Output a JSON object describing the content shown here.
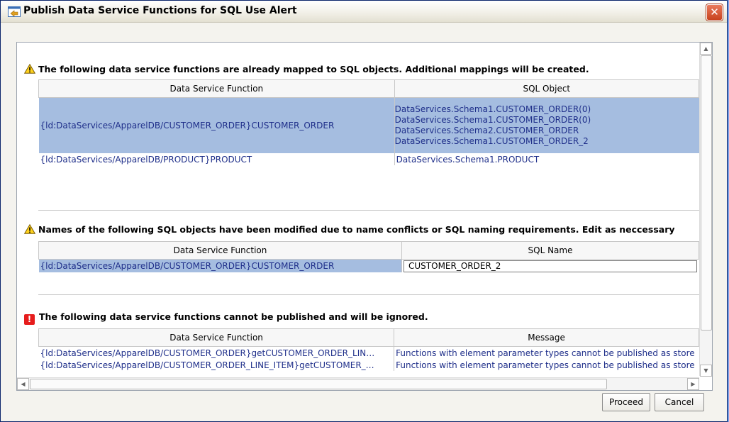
{
  "window": {
    "title": "Publish Data Service Functions for SQL Use Alert",
    "close_glyph": "✕"
  },
  "section1": {
    "heading": "The following data service functions are already mapped to SQL objects.  Additional mappings will be created.",
    "icon": "warning-icon",
    "columns": [
      "Data Service Function",
      "SQL Object"
    ],
    "rows": [
      {
        "function": "{ld:DataServices/ApparelDB/CUSTOMER_ORDER}CUSTOMER_ORDER",
        "sql_objects": [
          "DataServices.Schema1.CUSTOMER_ORDER(0)",
          "DataServices.Schema1.CUSTOMER_ORDER(0)",
          "DataServices.Schema2.CUSTOMER_ORDER",
          "DataServices.Schema1.CUSTOMER_ORDER_2"
        ],
        "selected": true
      },
      {
        "function": "{ld:DataServices/ApparelDB/PRODUCT}PRODUCT",
        "sql_objects": [
          "DataServices.Schema1.PRODUCT"
        ],
        "selected": false
      }
    ]
  },
  "section2": {
    "heading": "Names of the following SQL objects have been modified due to name conflicts or SQL naming requirements.  Edit as neccessary",
    "icon": "warning-icon",
    "columns": [
      "Data Service Function",
      "SQL Name"
    ],
    "rows": [
      {
        "function": "{ld:DataServices/ApparelDB/CUSTOMER_ORDER}CUSTOMER_ORDER",
        "sql_name": "CUSTOMER_ORDER_2"
      }
    ]
  },
  "section3": {
    "heading": "The following data service functions cannot be published and will be ignored.",
    "icon": "error-icon",
    "columns": [
      "Data Service Function",
      "Message"
    ],
    "rows": [
      {
        "function": "{ld:DataServices/ApparelDB/CUSTOMER_ORDER}getCUSTOMER_ORDER_LIN…",
        "message": "Functions with element parameter types cannot be published as store"
      },
      {
        "function": "{ld:DataServices/ApparelDB/CUSTOMER_ORDER_LINE_ITEM}getCUSTOMER_…",
        "message": "Functions with element parameter types cannot be published as store"
      }
    ]
  },
  "buttons": {
    "proceed": "Proceed",
    "cancel": "Cancel"
  },
  "colors": {
    "selection": "#a5bde0",
    "link_text": "#1f2f8a",
    "close_button": "#c8431e",
    "error_icon": "#e61c1c"
  }
}
